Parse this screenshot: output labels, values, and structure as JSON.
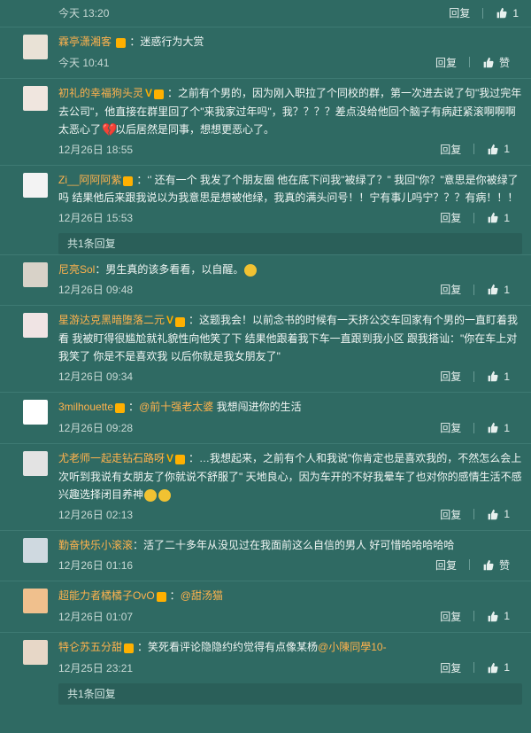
{
  "header_row": {
    "time": "今天 13:20",
    "reply_label": "回复",
    "like_count": "1"
  },
  "comments": [
    {
      "user": "霖亭潇湘客",
      "has_vip": true,
      "has_v": false,
      "text": "迷惑行为大赏",
      "time": "今天 10:41",
      "reply_label": "回复",
      "like_label": "赞",
      "like_count": ""
    },
    {
      "user": "初礼的幸福狗头灵",
      "has_vip": true,
      "has_v": true,
      "text": "之前有个男的，因为刚入职拉了个同校的群，第一次进去说了句\"我过完年去公司\"，他直接在群里回了个\"来我家过年吗\"，我？？？？差点没给他回个脑子有病赶紧滚啊啊啊太恶心了",
      "text2": "以后居然是同事，想想更恶心了。",
      "time": "12月26日 18:55",
      "reply_label": "回复",
      "like_count": "1"
    },
    {
      "user": "Zi__阿阿阿紫",
      "has_vip": true,
      "has_v": false,
      "text": "‘’ 还有一个 我发了个朋友圈 他在底下问我\"被绿了？\" 我回\"你？\"意思是你被绿了吗 结果他后来跟我说以为我意思是想被他绿，我真的满头问号！！宁有事儿吗宁？？？有病！！！",
      "time": "12月26日 15:53",
      "reply_label": "回复",
      "like_count": "1",
      "sub_reply": "共1条回复"
    },
    {
      "user": "尼亮Sol",
      "has_vip": false,
      "has_v": false,
      "text": "男生真的该多看看，以自醒。",
      "time": "12月26日 09:48",
      "reply_label": "回复",
      "like_count": "1"
    },
    {
      "user": "星游达克黑暗堕落二元",
      "has_vip": true,
      "has_v": true,
      "text": "这题我会！以前念书的时候有一天挤公交车回家有个男的一直盯着我看 我被盯得很尴尬就礼貌性向他笑了下 结果他跟着我下车一直跟到我小区 跟我搭讪：\"你在车上对我笑了 你是不是喜欢我 以后你就是我女朋友了\"",
      "time": "12月26日 09:34",
      "reply_label": "回复",
      "like_count": "1"
    },
    {
      "user": "3milhouette",
      "has_vip": true,
      "has_v": false,
      "mention": "@前十强老太婆",
      "text": " 我想闯进你的生活",
      "time": "12月26日 09:28",
      "reply_label": "回复",
      "like_count": "1"
    },
    {
      "user": "尤老师一起走钻石路呀",
      "has_vip": true,
      "has_v": true,
      "text": "…我想起来，之前有个人和我说\"你肯定也是喜欢我的，不然怎么会上次听到我说有女朋友了你就说不舒服了\" 天地良心，因为车开的不好我晕车了也对你的感情生活不感兴趣选择闭目养神",
      "time": "12月26日 02:13",
      "reply_label": "回复",
      "like_count": "1"
    },
    {
      "user": "勤奋快乐小滚滚",
      "has_vip": false,
      "has_v": false,
      "text": "活了二十多年从没见过在我面前这么自信的男人 好可惜哈哈哈哈哈",
      "time": "12月26日 01:16",
      "reply_label": "回复",
      "like_label": "赞",
      "like_count": ""
    },
    {
      "user": "超能力者橘橘子OvO",
      "has_vip": true,
      "has_v": false,
      "mention": "@甜汤猫",
      "text": "",
      "time": "12月26日 01:07",
      "reply_label": "回复",
      "like_count": "1"
    },
    {
      "user": "特仑苏五分甜",
      "has_vip": true,
      "has_v": false,
      "text": "笑死看评论隐隐约约觉得有点像某杨",
      "mention": "@小陳同學10-",
      "time": "12月25日 23:21",
      "reply_label": "回复",
      "like_count": "1",
      "sub_reply": "共1条回复"
    }
  ],
  "colors": {
    "bg": "#2f6a63",
    "username": "#ffb24d",
    "text": "#f0f6f4",
    "meta": "#c7d9d5"
  }
}
